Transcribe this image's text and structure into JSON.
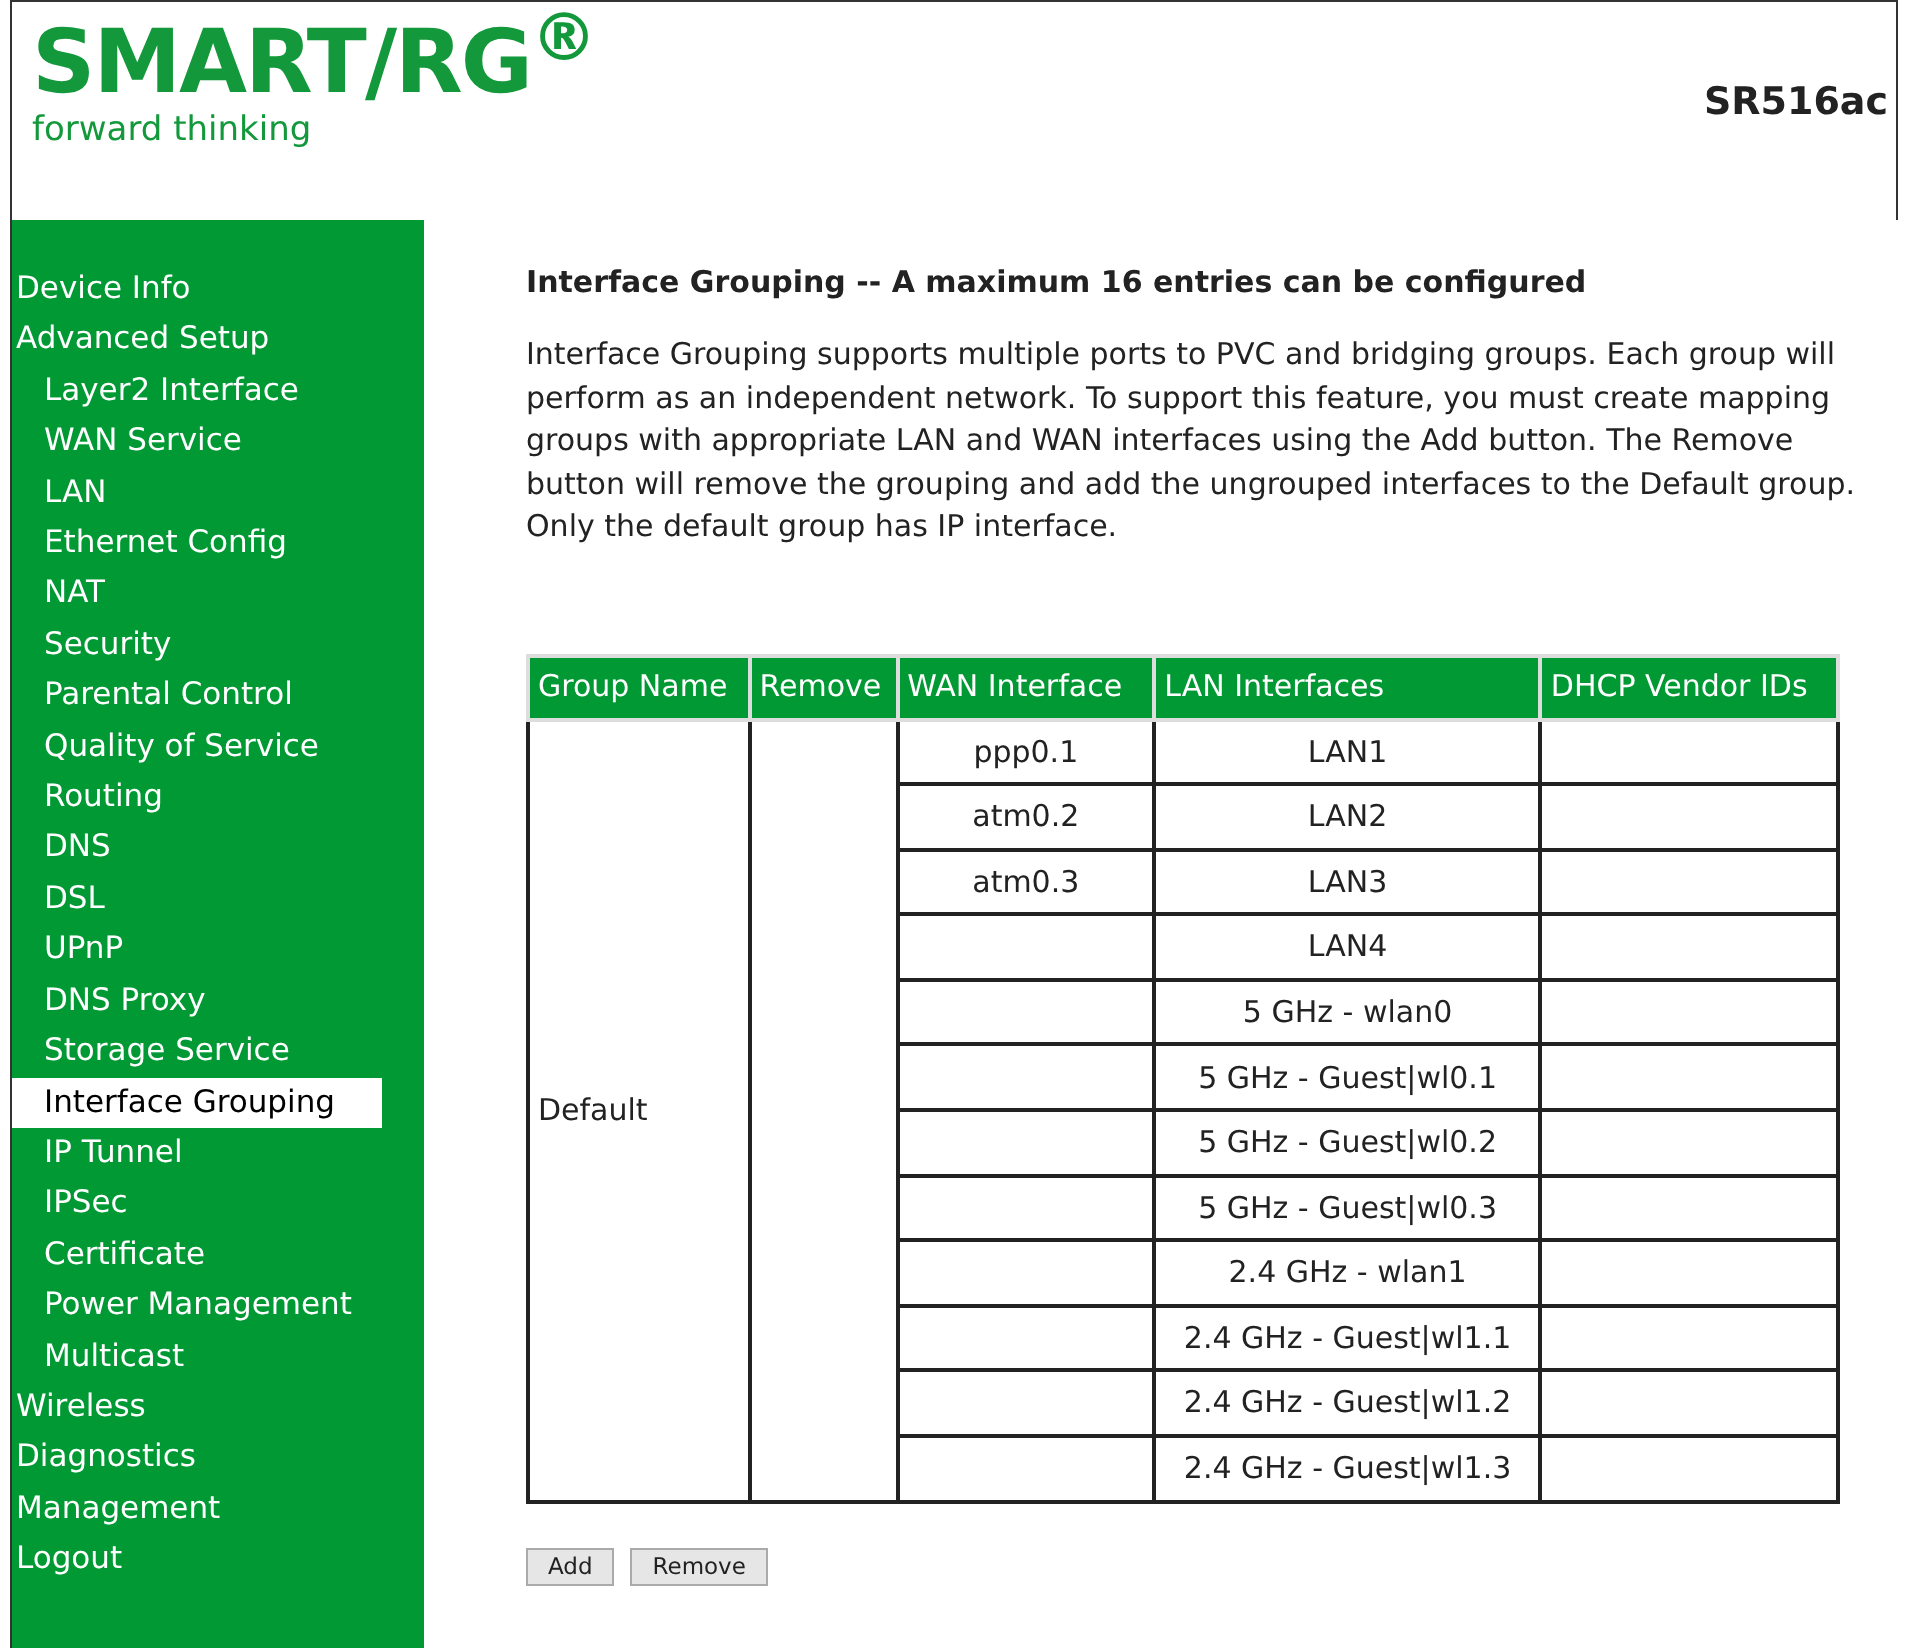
{
  "header": {
    "logo": "SMART/RG$^{®}$",
    "tagline": "forward thinking",
    "model": "SR516ac"
  },
  "sidebar": {
    "items": [
      {
        "label": "Device Info",
        "selected": false
      },
      {
        "label": "Advanced Setup",
        "selected": false,
        "children": [
          {
            "label": "Layer2 Interface",
            "selected": false
          },
          {
            "label": "WAN Service",
            "selected": false
          },
          {
            "label": "LAN",
            "selected": false
          },
          {
            "label": "Ethernet Config",
            "selected": false
          },
          {
            "label": "NAT",
            "selected": false
          },
          {
            "label": "Security",
            "selected": false
          },
          {
            "label": "Parental Control",
            "selected": false
          },
          {
            "label": "Quality of Service",
            "selected": false
          },
          {
            "label": "Routing",
            "selected": false
          },
          {
            "label": "DNS",
            "selected": false
          },
          {
            "label": "DSL",
            "selected": false
          },
          {
            "label": "UPnP",
            "selected": false
          },
          {
            "label": "DNS Proxy",
            "selected": false
          },
          {
            "label": "Storage Service",
            "selected": false
          },
          {
            "label": "Interface Grouping",
            "selected": true
          },
          {
            "label": "IP Tunnel",
            "selected": false
          },
          {
            "label": "IPSec",
            "selected": false
          },
          {
            "label": "Certificate",
            "selected": false
          },
          {
            "label": "Power Management",
            "selected": false
          },
          {
            "label": "Multicast",
            "selected": false
          }
        ]
      },
      {
        "label": "Wireless",
        "selected": false
      },
      {
        "label": "Diagnostics",
        "selected": false
      },
      {
        "label": "Management",
        "selected": false
      },
      {
        "label": "Logout",
        "selected": false
      }
    ]
  },
  "content": {
    "title": "Interface Grouping -- A maximum 16 entries can be configured",
    "description": "Interface Grouping supports multiple ports to PVC and bridging groups. Each group will perform as an independent network. To support this feature, you must create mapping groups with appropriate LAN and WAN interfaces using the Add button. The Remove button will remove the grouping and add the ungrouped interfaces to the Default group. Only the default group has IP interface."
  },
  "table": {
    "columns": [
      "Group Name",
      "Remove",
      "WAN Interface",
      "LAN Interfaces",
      "DHCP Vendor IDs"
    ],
    "groups": [
      {
        "name": "Default",
        "rows": [
          {
            "wan": "ppp0.1",
            "lan": "LAN1"
          },
          {
            "wan": "atm0.2",
            "lan": "LAN2"
          },
          {
            "wan": "atm0.3",
            "lan": "LAN3"
          },
          {
            "lan": "LAN4"
          },
          {
            "lan": "5 GHz - wlan0"
          },
          {
            "lan": "5 GHz - Guest|wl0.1"
          },
          {
            "lan": "5 GHz - Guest|wl0.2"
          },
          {
            "lan": "5 GHz - Guest|wl0.3"
          },
          {
            "lan": "2.4 GHz - wlan1"
          },
          {
            "lan": "2.4 GHz - Guest|wl1.1"
          },
          {
            "lan": "2.4 GHz - Guest|wl1.2"
          },
          {
            "lan": "2.4 GHz - Guest|wl1.3"
          }
        ]
      }
    ]
  },
  "buttons": [
    "Add",
    "Remove"
  ]
}
